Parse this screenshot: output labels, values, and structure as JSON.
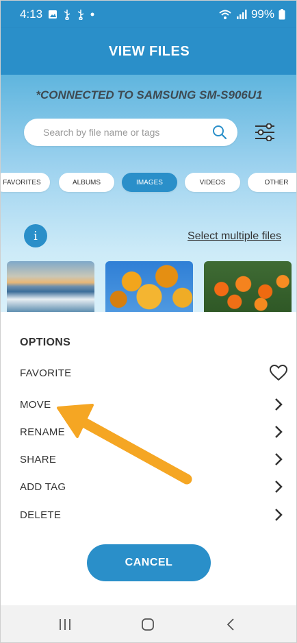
{
  "status_bar": {
    "time": "4:13",
    "battery": "99%",
    "icons": [
      "image-icon",
      "usb-icon",
      "usb-icon",
      "dot-icon",
      "wifi-icon",
      "signal-icon",
      "battery-icon"
    ]
  },
  "header": {
    "title": "VIEW FILES"
  },
  "connection": {
    "text": "*CONNECTED TO SAMSUNG SM-S906U1"
  },
  "search": {
    "placeholder": "Search by file name or tags"
  },
  "tabs": [
    {
      "label": "FAVORITES",
      "active": false
    },
    {
      "label": "ALBUMS",
      "active": false
    },
    {
      "label": "IMAGES",
      "active": true
    },
    {
      "label": "VIDEOS",
      "active": false
    },
    {
      "label": "OTHER",
      "active": false
    }
  ],
  "info": {
    "glyph": "i"
  },
  "select_multiple": "Select multiple files",
  "options": {
    "title": "OPTIONS",
    "items": [
      {
        "label": "FAVORITE",
        "icon": "heart-icon"
      },
      {
        "label": "MOVE",
        "icon": "chevron-right-icon"
      },
      {
        "label": "RENAME",
        "icon": "chevron-right-icon"
      },
      {
        "label": "SHARE",
        "icon": "chevron-right-icon"
      },
      {
        "label": "ADD TAG",
        "icon": "chevron-right-icon"
      },
      {
        "label": "DELETE",
        "icon": "chevron-right-icon"
      }
    ]
  },
  "cancel_label": "CANCEL",
  "colors": {
    "accent": "#2a8fc9",
    "annotation_arrow": "#f5a623"
  }
}
